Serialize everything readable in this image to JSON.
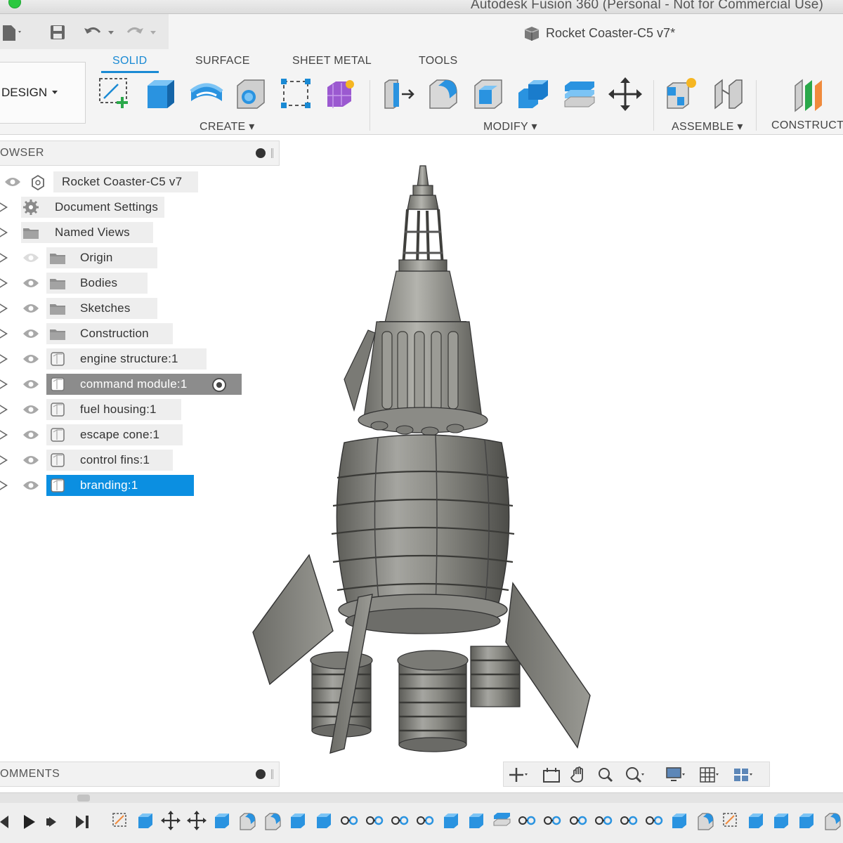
{
  "window": {
    "title": "Autodesk Fusion 360 (Personal - Not for Commercial Use)"
  },
  "document": {
    "tab_label": "Rocket Coaster-C5 v7*"
  },
  "workspace": {
    "label": "DESIGN"
  },
  "ribbon": {
    "tabs": [
      "SOLID",
      "SURFACE",
      "SHEET METAL",
      "TOOLS"
    ],
    "active_tab": "SOLID",
    "groups": {
      "create": "CREATE",
      "modify": "MODIFY",
      "assemble": "ASSEMBLE",
      "construct": "CONSTRUCT"
    }
  },
  "browser": {
    "title": "OWSER",
    "root": "Rocket Coaster-C5 v7",
    "items": [
      {
        "label": "Document Settings",
        "icon": "gear-icon"
      },
      {
        "label": "Named Views",
        "icon": "folder-icon"
      },
      {
        "label": "Origin",
        "icon": "folder-icon",
        "hidden": true
      },
      {
        "label": "Bodies",
        "icon": "folder-icon"
      },
      {
        "label": "Sketches",
        "icon": "folder-icon"
      },
      {
        "label": "Construction",
        "icon": "folder-icon"
      },
      {
        "label": "engine structure:1",
        "icon": "component-icon"
      },
      {
        "label": "command module:1",
        "icon": "component-icon",
        "state": "active"
      },
      {
        "label": "fuel housing:1",
        "icon": "component-icon"
      },
      {
        "label": "escape cone:1",
        "icon": "component-icon"
      },
      {
        "label": "control fins:1",
        "icon": "component-icon"
      },
      {
        "label": "branding:1",
        "icon": "component-icon",
        "state": "selected"
      }
    ]
  },
  "comments": {
    "title": "OMMENTS"
  },
  "colors": {
    "accent": "#1a8ad4",
    "selection": "#0b8fe1",
    "active_row": "#8c8c8c",
    "model": "#8a8a84"
  }
}
